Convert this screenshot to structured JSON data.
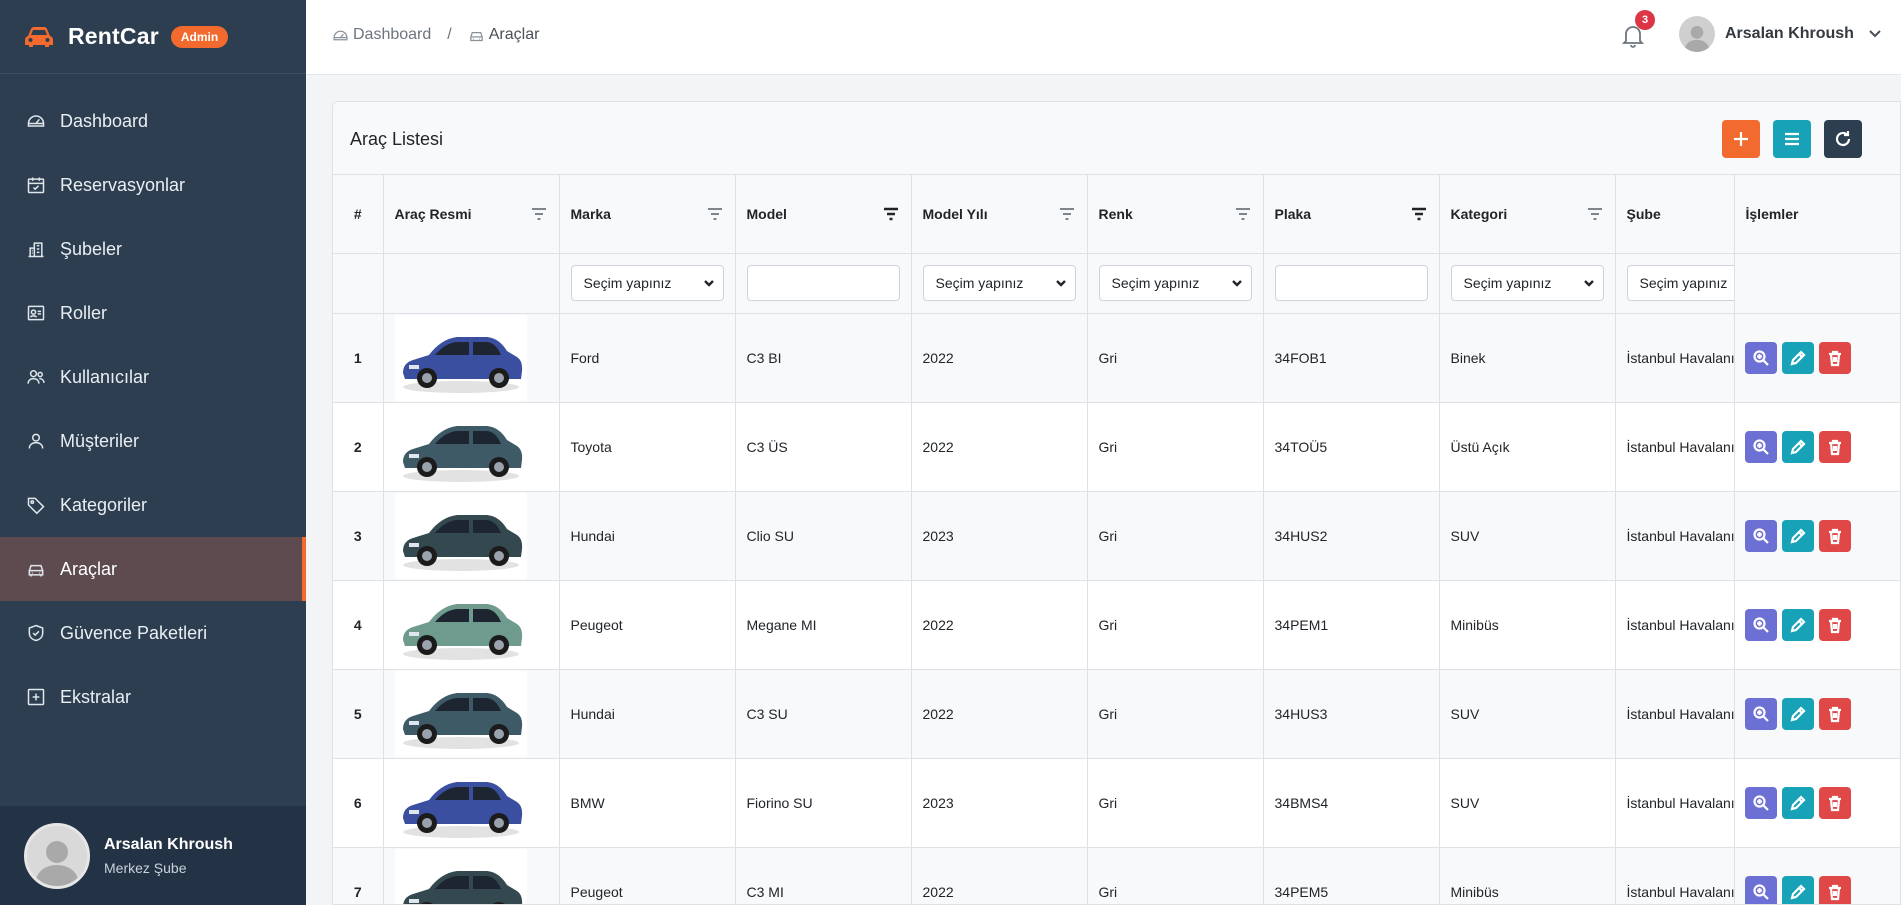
{
  "brand": {
    "name": "RentCar",
    "badge": "Admin",
    "accent": "#f26a2d"
  },
  "sidebar": {
    "items": [
      {
        "label": "Dashboard",
        "icon": "gauge-icon"
      },
      {
        "label": "Reservasyonlar",
        "icon": "calendar-icon"
      },
      {
        "label": "Şubeler",
        "icon": "building-icon"
      },
      {
        "label": "Roller",
        "icon": "id-card-icon"
      },
      {
        "label": "Kullanıcılar",
        "icon": "users-icon"
      },
      {
        "label": "Müşteriler",
        "icon": "user-icon"
      },
      {
        "label": "Kategoriler",
        "icon": "tag-icon"
      },
      {
        "label": "Araçlar",
        "icon": "car-icon",
        "active": true
      },
      {
        "label": "Güvence Paketleri",
        "icon": "shield-icon"
      },
      {
        "label": "Ekstralar",
        "icon": "plus-square-icon"
      }
    ],
    "user": {
      "name": "Arsalan Khroush",
      "branch": "Merkez Şube"
    }
  },
  "topbar": {
    "breadcrumb": {
      "home": "Dashboard",
      "separator": "/",
      "current": "Araçlar"
    },
    "notifications": {
      "count": "3"
    },
    "user": {
      "name": "Arsalan Khroush"
    }
  },
  "card": {
    "title": "Araç Listesi"
  },
  "table": {
    "headers": {
      "num": "#",
      "image": "Araç Resmi",
      "brand": "Marka",
      "model": "Model",
      "year": "Model Yılı",
      "color": "Renk",
      "plate": "Plaka",
      "category": "Kategori",
      "branch": "Şube",
      "actions": "İşlemler"
    },
    "filters": {
      "brand": "Seçim yapınız",
      "year": "Seçim yapınız",
      "color": "Seçim yapınız",
      "category": "Seçim yapınız",
      "branch": "Seçim yapınız"
    },
    "rows": [
      {
        "num": "1",
        "brand": "Ford",
        "model": "C3 BI",
        "year": "2022",
        "color": "Gri",
        "plate": "34FOB1",
        "category": "Binek",
        "branch": "İstanbul Havalanı",
        "car_color": "#3a4fa0"
      },
      {
        "num": "2",
        "brand": "Toyota",
        "model": "C3 ÜS",
        "year": "2022",
        "color": "Gri",
        "plate": "34TOÜ5",
        "category": "Üstü Açık",
        "branch": "İstanbul Havalanı",
        "car_color": "#3d5a66"
      },
      {
        "num": "3",
        "brand": "Hundai",
        "model": "Clio SU",
        "year": "2023",
        "color": "Gri",
        "plate": "34HUS2",
        "category": "SUV",
        "branch": "İstanbul Havalanı",
        "car_color": "#34494f"
      },
      {
        "num": "4",
        "brand": "Peugeot",
        "model": "Megane MI",
        "year": "2022",
        "color": "Gri",
        "plate": "34PEM1",
        "category": "Minibüs",
        "branch": "İstanbul Havalanı",
        "car_color": "#6f9a8e"
      },
      {
        "num": "5",
        "brand": "Hundai",
        "model": "C3 SU",
        "year": "2022",
        "color": "Gri",
        "plate": "34HUS3",
        "category": "SUV",
        "branch": "İstanbul Havalanı",
        "car_color": "#3d5a66"
      },
      {
        "num": "6",
        "brand": "BMW",
        "model": "Fiorino SU",
        "year": "2023",
        "color": "Gri",
        "plate": "34BMS4",
        "category": "SUV",
        "branch": "İstanbul Havalanı",
        "car_color": "#3a4fa0"
      },
      {
        "num": "7",
        "brand": "Peugeot",
        "model": "C3 MI",
        "year": "2022",
        "color": "Gri",
        "plate": "34PEM5",
        "category": "Minibüs",
        "branch": "İstanbul Havalanı",
        "car_color": "#34494f"
      }
    ]
  }
}
